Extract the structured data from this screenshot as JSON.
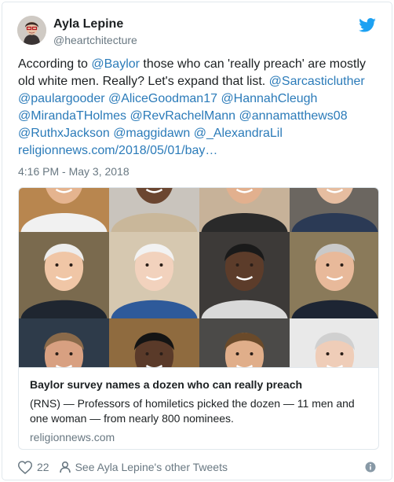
{
  "author": {
    "name": "Ayla Lepine",
    "handle": "@heartchitecture"
  },
  "tweet": {
    "segments": [
      {
        "text": "According to ",
        "link": false
      },
      {
        "text": "@Baylor",
        "link": true
      },
      {
        "text": " those who can 'really preach' are mostly old white men. Really? Let's expand that list. ",
        "link": false
      },
      {
        "text": "@Sarcasticluther",
        "link": true
      },
      {
        "text": " ",
        "link": false
      },
      {
        "text": "@paulargooder",
        "link": true
      },
      {
        "text": " ",
        "link": false
      },
      {
        "text": "@AliceGoodman17",
        "link": true
      },
      {
        "text": " ",
        "link": false
      },
      {
        "text": "@HannahCleugh",
        "link": true
      },
      {
        "text": " ",
        "link": false
      },
      {
        "text": "@MirandaTHolmes",
        "link": true
      },
      {
        "text": " ",
        "link": false
      },
      {
        "text": "@RevRachelMann",
        "link": true
      },
      {
        "text": " ",
        "link": false
      },
      {
        "text": "@annamatthews08",
        "link": true
      },
      {
        "text": " ",
        "link": false
      },
      {
        "text": "@RuthxJackson",
        "link": true
      },
      {
        "text": " ",
        "link": false
      },
      {
        "text": "@maggidawn",
        "link": true
      },
      {
        "text": " ",
        "link": false
      },
      {
        "text": "@_AlexandraLil",
        "link": true
      },
      {
        "text": " ",
        "link": false
      },
      {
        "text": "religionnews.com/2018/05/01/bay…",
        "link": true
      }
    ],
    "timestamp": "4:16 PM - May 3, 2018"
  },
  "card": {
    "title": "Baylor survey names a dozen who can really preach",
    "description": "(RNS) — Professors of homiletics picked the dozen — 11 men and one woman — from nearly 800 nominees.",
    "domain": "religionnews.com",
    "image_icon": "portrait-grid-image"
  },
  "footer": {
    "likes": "22",
    "see_more": "See Ayla Lepine's other Tweets"
  },
  "colors": {
    "link": "#2b7bb9",
    "twitter_blue": "#1da1f2",
    "muted": "#697882"
  }
}
